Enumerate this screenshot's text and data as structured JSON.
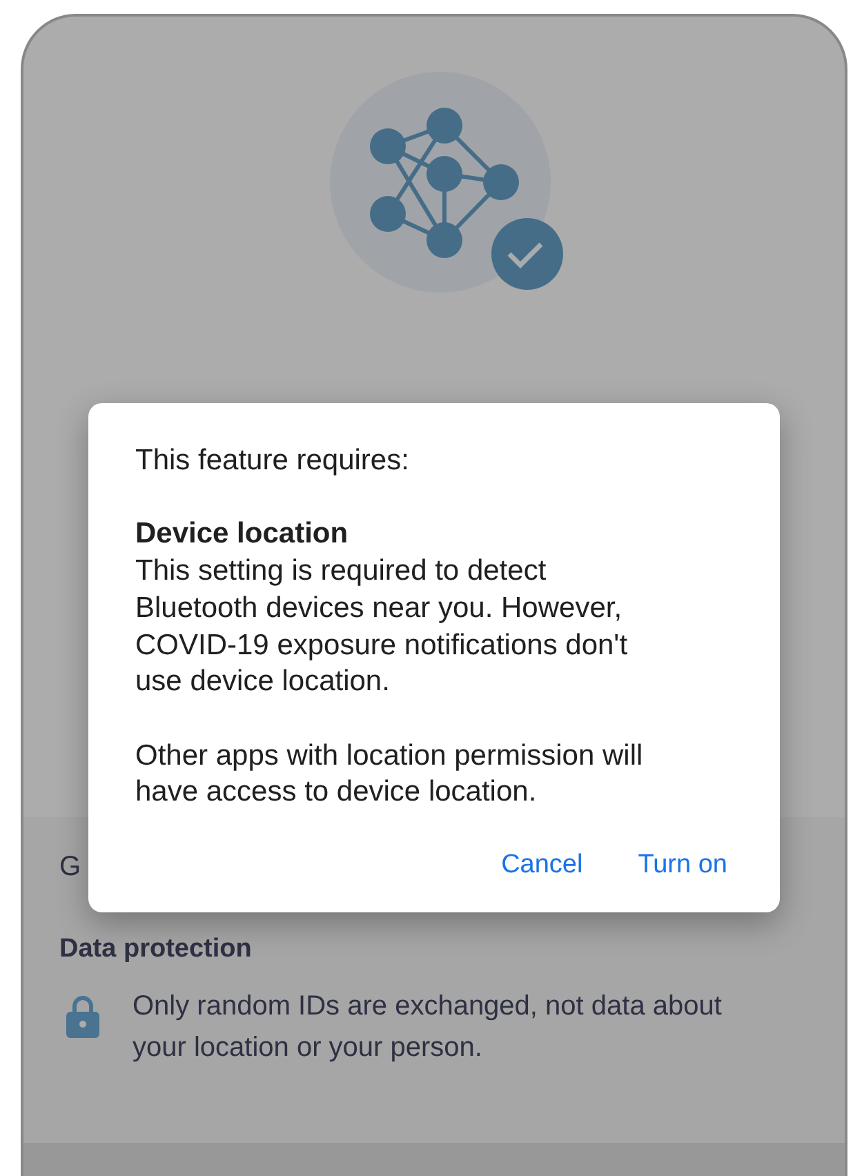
{
  "background": {
    "section_label": "G",
    "heading": "Data protection",
    "notice": "Only random IDs are exchanged, not data about your location or your person."
  },
  "dialog": {
    "intro": "This feature requires:",
    "title": "Device location",
    "body": "This setting is required to detect Bluetooth devices near you. However, COVID-19 exposure notifications don't use device location.",
    "note": "Other apps with location permission will have access to device location.",
    "buttons": [
      {
        "label": "Cancel"
      },
      {
        "label": "Turn on"
      }
    ]
  }
}
